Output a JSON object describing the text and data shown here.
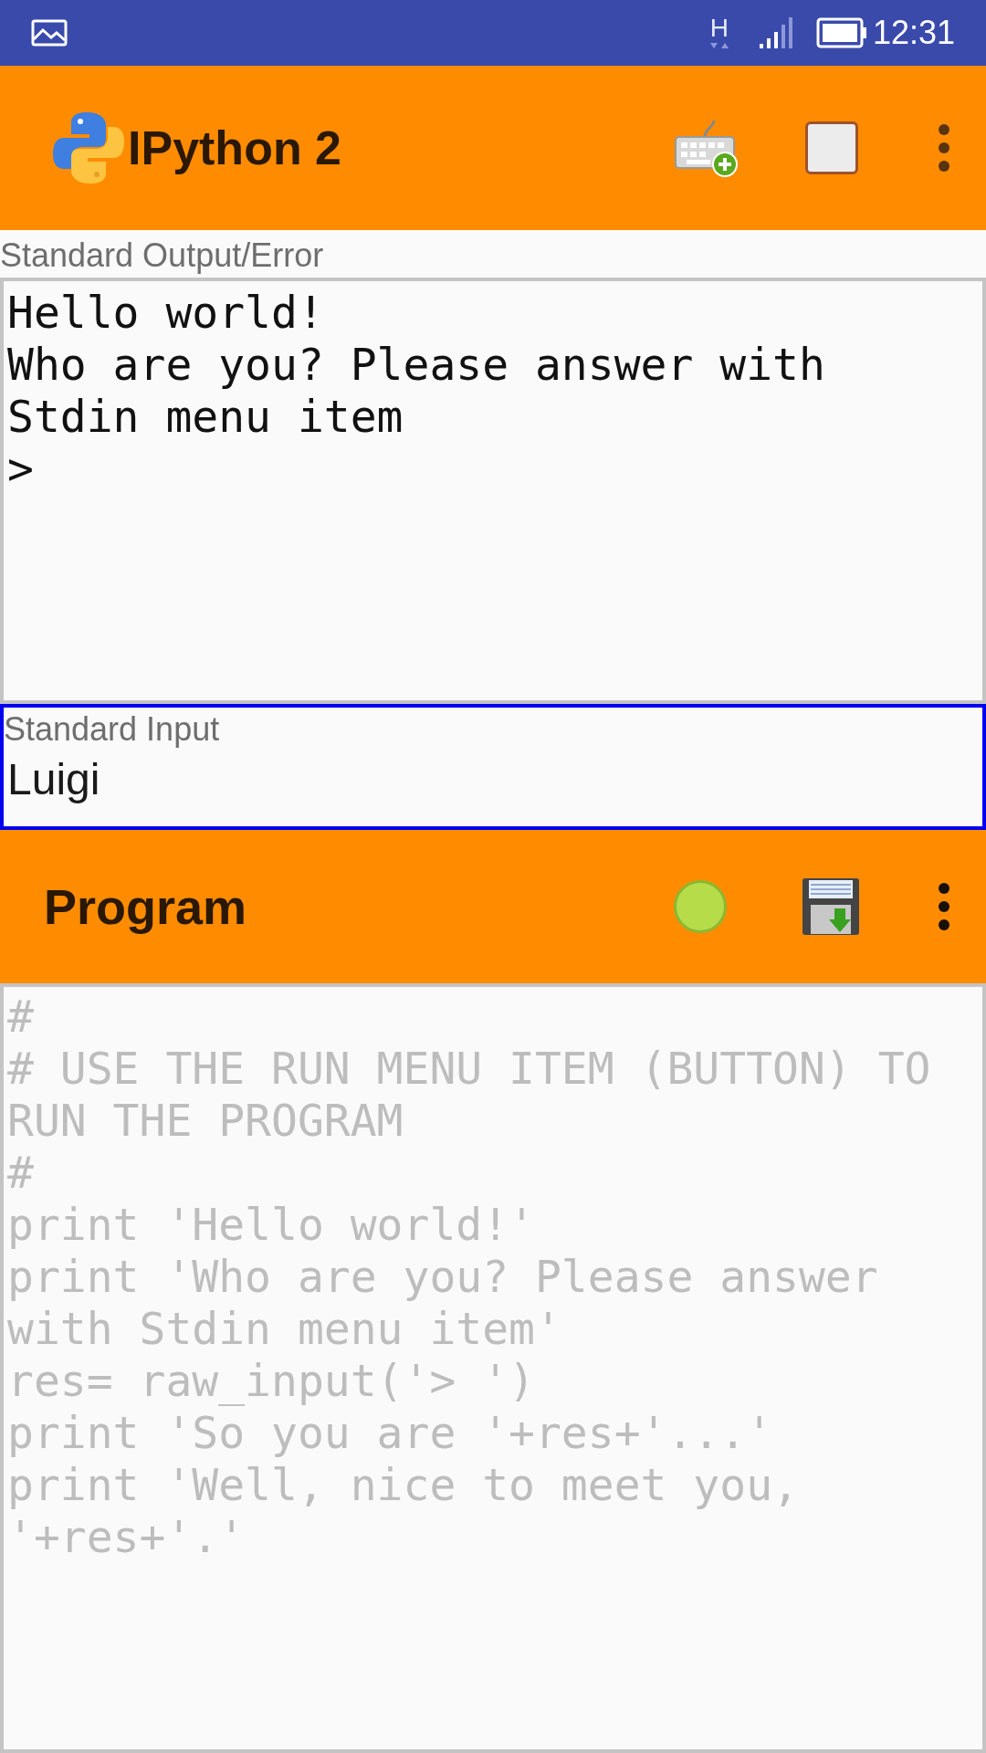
{
  "status_bar": {
    "network": "H",
    "time": "12:31"
  },
  "app_bar": {
    "title": "IPython 2"
  },
  "output": {
    "label": "Standard Output/Error",
    "lines": [
      "Hello world!",
      "Who are you? Please answer with Stdin menu item",
      ">"
    ]
  },
  "input": {
    "label": "Standard Input",
    "value": "Luigi"
  },
  "program_bar": {
    "title": "Program"
  },
  "program": {
    "lines": [
      "#",
      "# USE THE RUN MENU ITEM (BUTTON) TO RUN THE PROGRAM",
      "#",
      "print 'Hello world!'",
      "print 'Who are you? Please answer with Stdin menu item'",
      "res= raw_input('> ')",
      "print 'So you are '+res+'...'",
      "print 'Well, nice to meet you, '+res+'.'"
    ]
  }
}
